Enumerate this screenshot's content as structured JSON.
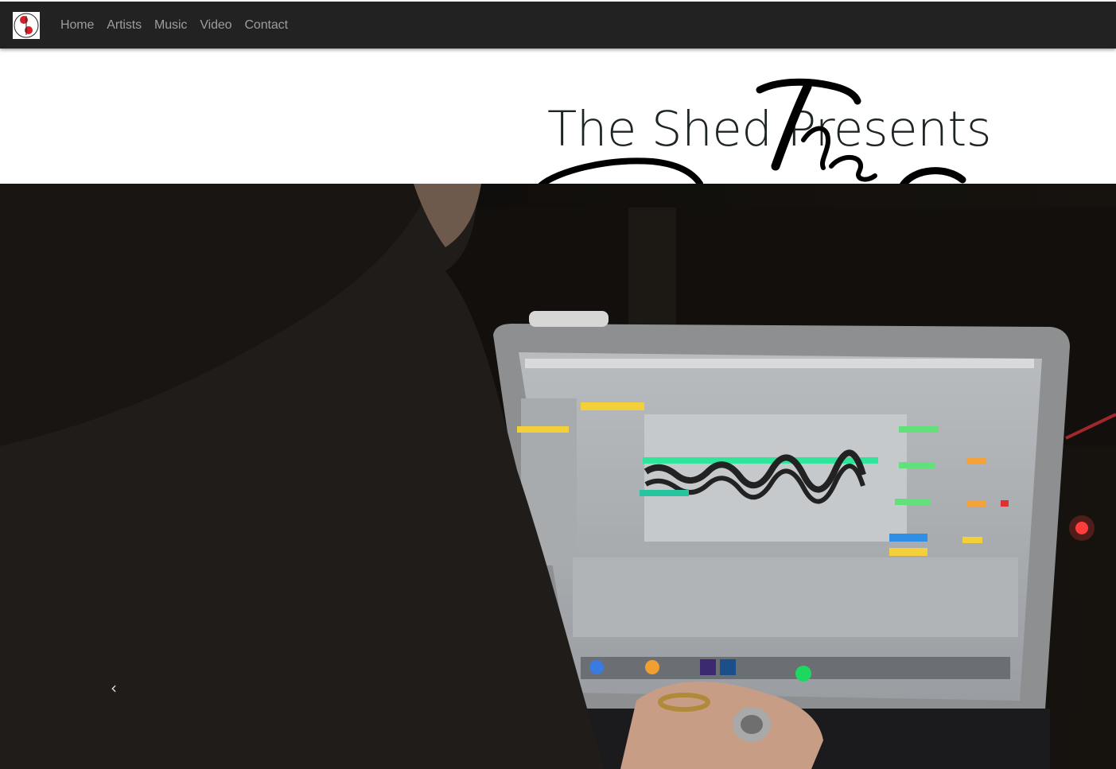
{
  "navbar": {
    "brand_icon": "shed-logo-icon",
    "links": [
      "Home",
      "Artists",
      "Music",
      "Video",
      "Contact"
    ]
  },
  "header": {
    "title": "The Shed Presents"
  },
  "carousel": {
    "prev_icon": "chevron-left-icon",
    "prev_glyph": "‹"
  },
  "colors": {
    "navbar_bg": "#222222",
    "nav_link": "#9d9d9d",
    "title": "#1d2425",
    "accent_red": "#d42027"
  }
}
